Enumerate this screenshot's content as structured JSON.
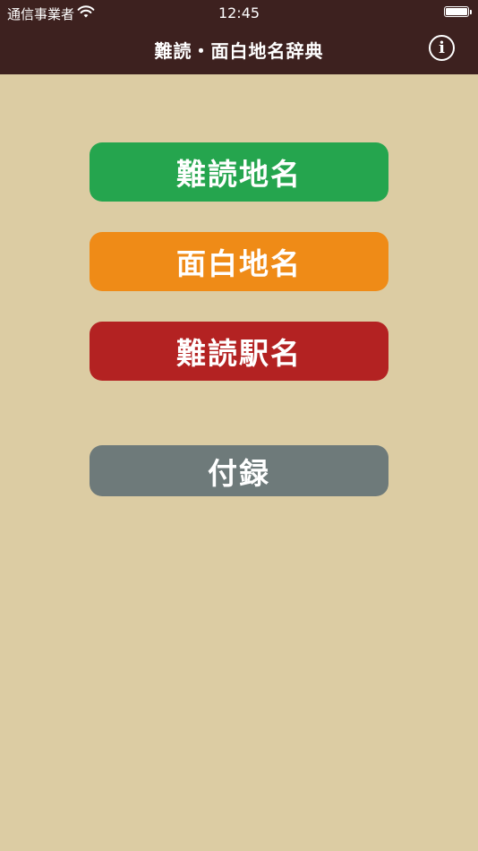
{
  "status_bar": {
    "carrier": "通信事業者",
    "time": "12:45"
  },
  "nav": {
    "title": "難読・面白地名辞典",
    "info_icon": "info-icon"
  },
  "menu": {
    "buttons": [
      {
        "label": "難読地名",
        "color": "#25a54e"
      },
      {
        "label": "面白地名",
        "color": "#ef8b17"
      },
      {
        "label": "難読駅名",
        "color": "#b32222"
      },
      {
        "label": "付録",
        "color": "#6e7a7a"
      }
    ]
  },
  "colors": {
    "background": "#dccca3",
    "header": "#3d211f"
  }
}
